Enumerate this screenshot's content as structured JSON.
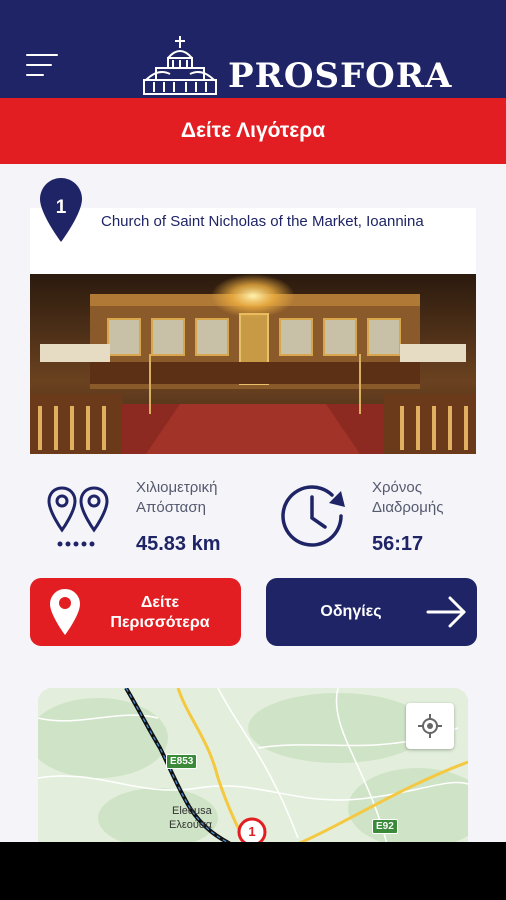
{
  "header": {
    "brand": "PROSFORA",
    "menu_icon": "hamburger-menu-icon",
    "logo_icon": "church-icon"
  },
  "banner": {
    "label": "Δείτε Λιγότερα"
  },
  "place": {
    "number": "1",
    "title": "Church of Saint Nicholas of the Market, Ioannina"
  },
  "stats": {
    "distance": {
      "label_line1": "Χιλιομετρική",
      "label_line2": "Απόσταση",
      "value": "45.83 km",
      "icon": "route-pins-icon"
    },
    "duration": {
      "label_line1": "Χρόνος",
      "label_line2": "Διαδρομής",
      "value": "56:17",
      "icon": "clock-icon"
    }
  },
  "buttons": {
    "more_line1": "Δείτε",
    "more_line2": "Περισσότερα",
    "directions": "Οδηγίες"
  },
  "map": {
    "town_latin": "Eleousa",
    "town_greek": "Ελεούσα",
    "road_1": "E853",
    "road_2": "E92",
    "pin_number": "1"
  },
  "colors": {
    "navy": "#1f2466",
    "red": "#e21e22",
    "background": "#f4f4f9"
  }
}
